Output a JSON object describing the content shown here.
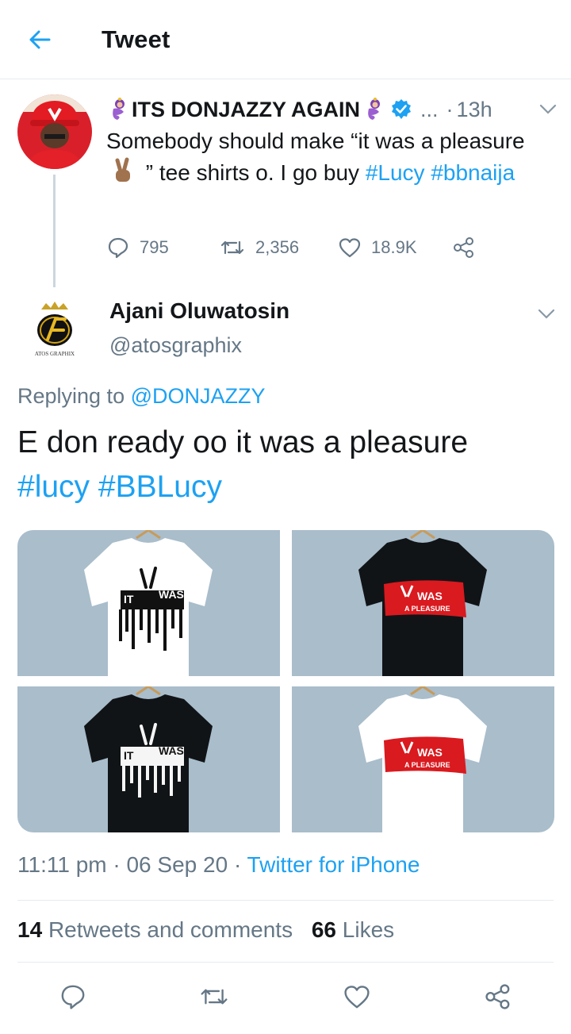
{
  "header": {
    "title": "Tweet",
    "back_icon": "arrow-left-icon"
  },
  "original_tweet": {
    "author_name": "ITS DONJAZZY AGAIN",
    "more": "...",
    "separator": "·",
    "time": "13h",
    "text_part1": "Somebody should make “it was a pleasure",
    "text_part2": "” tee shirts o. I go buy",
    "hashtag1": "#Lucy",
    "hashtag2": "#bbnaija",
    "replies": "795",
    "retweets": "2,356",
    "likes": "18.9K"
  },
  "reply_tweet": {
    "author_name": "Ajani Oluwatosin",
    "handle": "@atosgraphix",
    "replying_prefix": "Replying to",
    "replying_mention": "@DONJAZZY",
    "text": "E don ready oo it was a pleasure",
    "hashtag1": "#lucy",
    "hashtag2": "#BBLucy",
    "avatar_caption": "ATOS GRAPHIX",
    "shirt_print_line1": "IT",
    "shirt_print_line2": "WAS",
    "shirt_print_line3": "A PLEASURE",
    "timestamp": "11:11 pm",
    "date": "06 Sep 20",
    "dot": "·",
    "source": "Twitter for iPhone"
  },
  "stats": {
    "retweets_count": "14",
    "retweets_label": "Retweets and comments",
    "likes_count": "66",
    "likes_label": "Likes"
  },
  "colors": {
    "accent": "#1da1f2",
    "secondary_text": "#657786",
    "divider": "#e6ecf0",
    "media_bg": "#a9bdcb"
  }
}
